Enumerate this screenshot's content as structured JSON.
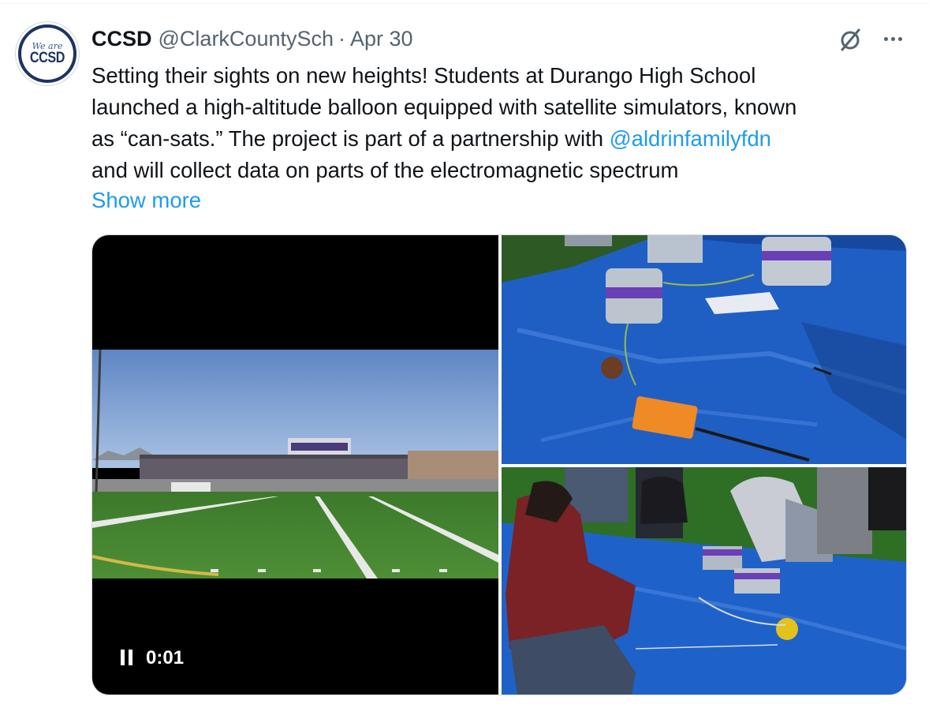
{
  "tweet": {
    "author_name": "CCSD",
    "author_handle": "@ClarkCountySch",
    "separator": "·",
    "date": "Apr 30",
    "avatar": {
      "script": "We are",
      "text": "CCSD"
    },
    "text_lines": [
      "Setting their sights on new heights! Students at Durango High School",
      "launched a high-altitude balloon equipped with satellite simulators, known",
      "as “can-sats.” The project is part of a partnership with "
    ],
    "mention": "@aldrinfamilyfdn",
    "text_last_line": "and will collect data on parts of the electromagnetic spectrum",
    "show_more": "Show more"
  },
  "video": {
    "timestamp": "0:01",
    "state": "playing"
  },
  "icons": {
    "grok": "grok-icon",
    "more": "more-options-icon",
    "pause": "pause-icon"
  },
  "colors": {
    "link": "#1d9bf0",
    "secondary_text": "#536471",
    "text": "#0f1419",
    "border": "#cfd9de"
  }
}
